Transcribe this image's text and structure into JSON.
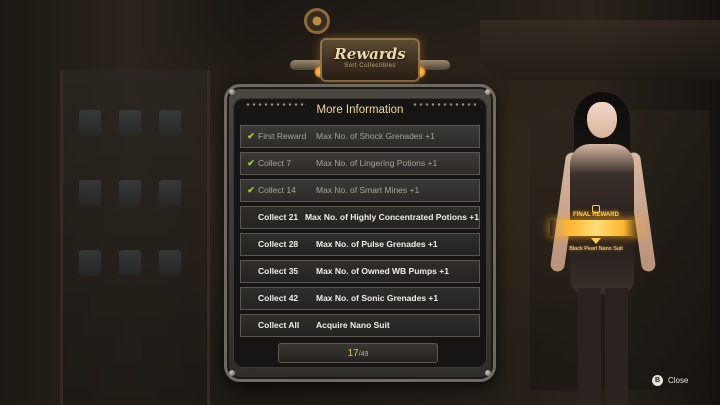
{
  "header": {
    "title": "Rewards",
    "subtitle": "Sort Collectibles"
  },
  "panel": {
    "title": "More Information",
    "rows": [
      {
        "completed": true,
        "milestone": "First Reward",
        "reward": "Max No. of Shock Grenades +1"
      },
      {
        "completed": true,
        "milestone": "Collect 7",
        "reward": "Max No. of Lingering Potions +1"
      },
      {
        "completed": true,
        "milestone": "Collect 14",
        "reward": "Max No. of Smart Mines +1"
      },
      {
        "completed": false,
        "milestone": "Collect 21",
        "reward": "Max No. of Highly Concentrated Potions +1"
      },
      {
        "completed": false,
        "milestone": "Collect 28",
        "reward": "Max No. of Pulse Grenades +1"
      },
      {
        "completed": false,
        "milestone": "Collect 35",
        "reward": "Max No. of Owned WB Pumps +1"
      },
      {
        "completed": false,
        "milestone": "Collect 42",
        "reward": "Max No. of Sonic Grenades +1"
      },
      {
        "completed": false,
        "milestone": "Collect All",
        "reward": "Acquire Nano Suit"
      }
    ],
    "counter": {
      "current": "17",
      "separator": "/",
      "total": "49"
    }
  },
  "final_reward": {
    "label": "FINAL REWARD",
    "item": "Black Pearl Nano Suit",
    "arrow_icon": "chevron-down-icon"
  },
  "close_hint": {
    "button_glyph": "B",
    "label": "Close",
    "icon": "controller-button-icon"
  },
  "colors": {
    "accent_gold": "#f2c34a",
    "check_green": "#9dd23c",
    "panel_title": "#f1d89b"
  }
}
